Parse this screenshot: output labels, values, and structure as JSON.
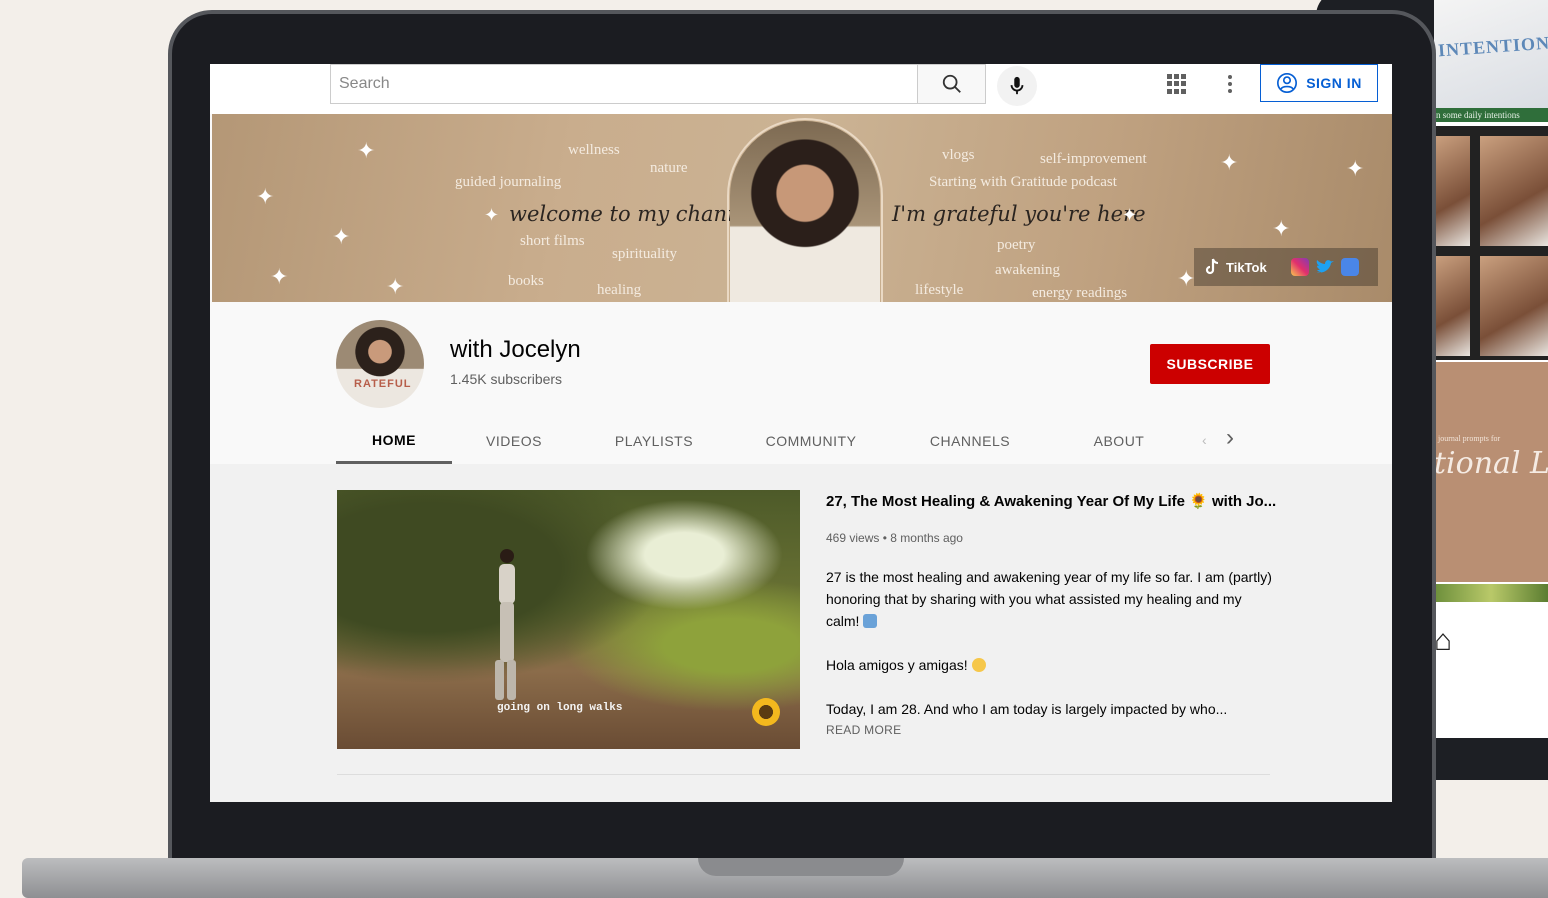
{
  "header": {
    "search_placeholder": "Search",
    "signin_label": "SIGN IN"
  },
  "banner": {
    "words_left": [
      "wellness",
      "nature",
      "guided journaling",
      "short films",
      "spirituality",
      "books",
      "healing"
    ],
    "words_right": [
      "vlogs",
      "self-improvement",
      "Starting with Gratitude podcast",
      "poetry",
      "awakening",
      "lifestyle",
      "energy readings"
    ],
    "script_left": "welcome to my channel",
    "script_right": "I'm grateful you're here",
    "tiktok_label": "TikTok"
  },
  "channel": {
    "name": "with Jocelyn",
    "subscribers": "1.45K subscribers",
    "subscribe_label": "SUBSCRIBE",
    "avatar_text": "RATEFUL",
    "tabs": [
      "HOME",
      "VIDEOS",
      "PLAYLISTS",
      "COMMUNITY",
      "CHANNELS",
      "ABOUT"
    ],
    "active_tab": "HOME"
  },
  "featured_video": {
    "thumbnail_caption": "going on long walks",
    "title": "27, The Most Healing & Awakening Year Of My Life 🌻 with Jo...",
    "views": "469 views",
    "age": "8 months ago",
    "desc_1": "27 is the most healing and awakening year of my life so far. I am (partly) honoring that by sharing with you what assisted my healing and my calm!",
    "desc_2": "Hola amigos y amigas!",
    "desc_3": "Today, I am 28. And who I am today is largely impacted by who...",
    "read_more": "READ MORE"
  },
  "phone": {
    "shirt_text": "INTENTIONA",
    "banner_text": "n some daily intentions",
    "small_text": "journal prompts for",
    "script_text": "tional Liv"
  },
  "colors": {
    "brand_blue": "#065fd4",
    "subscribe_red": "#cc0000",
    "banner_tan": "#c9ad8d"
  }
}
